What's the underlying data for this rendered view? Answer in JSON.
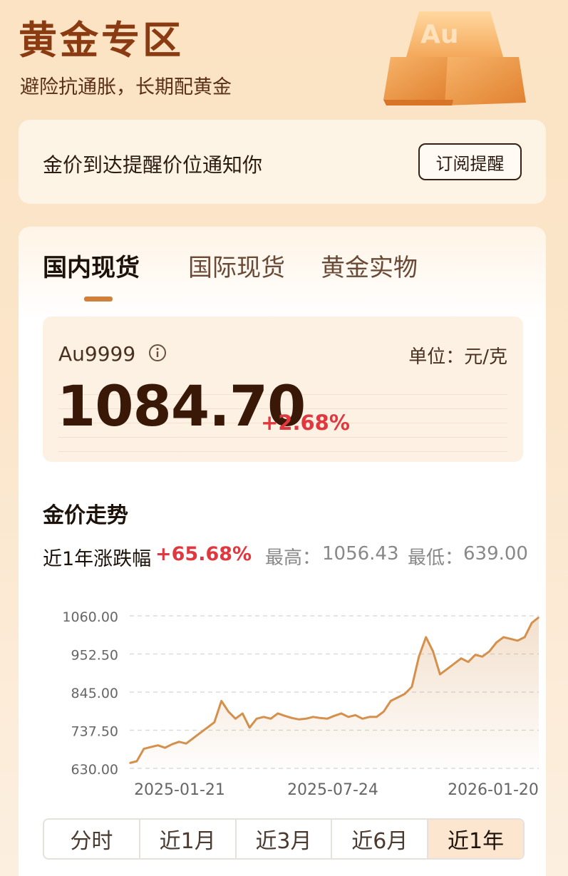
{
  "header": {
    "title": "黄金专区",
    "subtitle": "避险抗通胀，长期配黄金",
    "bar_label": "Au"
  },
  "notice": {
    "text": "金价到达提醒价位通知你",
    "button": "订阅提醒"
  },
  "tabs": [
    {
      "label": "国内现货",
      "active": true
    },
    {
      "label": "国际现货",
      "active": false
    },
    {
      "label": "黄金实物",
      "active": false
    }
  ],
  "quote": {
    "symbol": "Au9999",
    "unit": "单位：元/克",
    "price": "1084.70",
    "change": "+2.68%"
  },
  "trend": {
    "title": "金价走势",
    "range_label": "近1年涨跌幅",
    "range_value": "+65.68%",
    "high_label": "最高：",
    "high_value": "1056.43",
    "low_label": "最低：",
    "low_value": "639.00"
  },
  "periods": [
    {
      "label": "分时",
      "active": false
    },
    {
      "label": "近1月",
      "active": false
    },
    {
      "label": "近3月",
      "active": false
    },
    {
      "label": "近6月",
      "active": false
    },
    {
      "label": "近1年",
      "active": true
    }
  ],
  "colors": {
    "accent": "#d0803a",
    "line": "#d4904c",
    "up": "#e0383e",
    "title": "#8a3b12"
  },
  "chart_data": {
    "type": "area",
    "title": "",
    "xlabel": "",
    "ylabel": "",
    "ylim": [
      630,
      1060
    ],
    "y_ticks": [
      "1060.00",
      "952.50",
      "845.00",
      "737.50",
      "630.00"
    ],
    "x_ticks": [
      "2025-01-21",
      "2025-07-24",
      "2026-01-20"
    ],
    "grid": true,
    "series": [
      {
        "values": [
          645,
          650,
          685,
          690,
          695,
          688,
          698,
          705,
          700,
          715,
          730,
          745,
          760,
          820,
          790,
          770,
          785,
          745,
          770,
          775,
          770,
          785,
          778,
          772,
          768,
          770,
          775,
          772,
          770,
          778,
          785,
          775,
          780,
          770,
          775,
          775,
          790,
          820,
          830,
          840,
          860,
          945,
          1000,
          960,
          895,
          910,
          925,
          940,
          930,
          950,
          945,
          960,
          985,
          1000,
          995,
          990,
          1000,
          1040,
          1056
        ]
      }
    ]
  }
}
